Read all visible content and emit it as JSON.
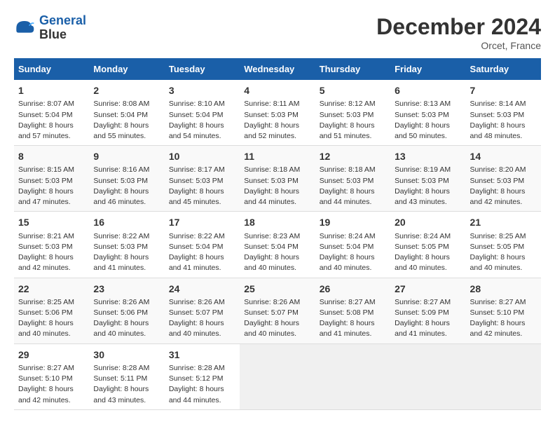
{
  "header": {
    "logo_line1": "General",
    "logo_line2": "Blue",
    "month": "December 2024",
    "location": "Orcet, France"
  },
  "days_of_week": [
    "Sunday",
    "Monday",
    "Tuesday",
    "Wednesday",
    "Thursday",
    "Friday",
    "Saturday"
  ],
  "weeks": [
    [
      {
        "num": "1",
        "sr": "8:07 AM",
        "ss": "5:04 PM",
        "dl": "8 hours and 57 minutes."
      },
      {
        "num": "2",
        "sr": "8:08 AM",
        "ss": "5:04 PM",
        "dl": "8 hours and 55 minutes."
      },
      {
        "num": "3",
        "sr": "8:10 AM",
        "ss": "5:04 PM",
        "dl": "8 hours and 54 minutes."
      },
      {
        "num": "4",
        "sr": "8:11 AM",
        "ss": "5:03 PM",
        "dl": "8 hours and 52 minutes."
      },
      {
        "num": "5",
        "sr": "8:12 AM",
        "ss": "5:03 PM",
        "dl": "8 hours and 51 minutes."
      },
      {
        "num": "6",
        "sr": "8:13 AM",
        "ss": "5:03 PM",
        "dl": "8 hours and 50 minutes."
      },
      {
        "num": "7",
        "sr": "8:14 AM",
        "ss": "5:03 PM",
        "dl": "8 hours and 48 minutes."
      }
    ],
    [
      {
        "num": "8",
        "sr": "8:15 AM",
        "ss": "5:03 PM",
        "dl": "8 hours and 47 minutes."
      },
      {
        "num": "9",
        "sr": "8:16 AM",
        "ss": "5:03 PM",
        "dl": "8 hours and 46 minutes."
      },
      {
        "num": "10",
        "sr": "8:17 AM",
        "ss": "5:03 PM",
        "dl": "8 hours and 45 minutes."
      },
      {
        "num": "11",
        "sr": "8:18 AM",
        "ss": "5:03 PM",
        "dl": "8 hours and 44 minutes."
      },
      {
        "num": "12",
        "sr": "8:18 AM",
        "ss": "5:03 PM",
        "dl": "8 hours and 44 minutes."
      },
      {
        "num": "13",
        "sr": "8:19 AM",
        "ss": "5:03 PM",
        "dl": "8 hours and 43 minutes."
      },
      {
        "num": "14",
        "sr": "8:20 AM",
        "ss": "5:03 PM",
        "dl": "8 hours and 42 minutes."
      }
    ],
    [
      {
        "num": "15",
        "sr": "8:21 AM",
        "ss": "5:03 PM",
        "dl": "8 hours and 42 minutes."
      },
      {
        "num": "16",
        "sr": "8:22 AM",
        "ss": "5:03 PM",
        "dl": "8 hours and 41 minutes."
      },
      {
        "num": "17",
        "sr": "8:22 AM",
        "ss": "5:04 PM",
        "dl": "8 hours and 41 minutes."
      },
      {
        "num": "18",
        "sr": "8:23 AM",
        "ss": "5:04 PM",
        "dl": "8 hours and 40 minutes."
      },
      {
        "num": "19",
        "sr": "8:24 AM",
        "ss": "5:04 PM",
        "dl": "8 hours and 40 minutes."
      },
      {
        "num": "20",
        "sr": "8:24 AM",
        "ss": "5:05 PM",
        "dl": "8 hours and 40 minutes."
      },
      {
        "num": "21",
        "sr": "8:25 AM",
        "ss": "5:05 PM",
        "dl": "8 hours and 40 minutes."
      }
    ],
    [
      {
        "num": "22",
        "sr": "8:25 AM",
        "ss": "5:06 PM",
        "dl": "8 hours and 40 minutes."
      },
      {
        "num": "23",
        "sr": "8:26 AM",
        "ss": "5:06 PM",
        "dl": "8 hours and 40 minutes."
      },
      {
        "num": "24",
        "sr": "8:26 AM",
        "ss": "5:07 PM",
        "dl": "8 hours and 40 minutes."
      },
      {
        "num": "25",
        "sr": "8:26 AM",
        "ss": "5:07 PM",
        "dl": "8 hours and 40 minutes."
      },
      {
        "num": "26",
        "sr": "8:27 AM",
        "ss": "5:08 PM",
        "dl": "8 hours and 41 minutes."
      },
      {
        "num": "27",
        "sr": "8:27 AM",
        "ss": "5:09 PM",
        "dl": "8 hours and 41 minutes."
      },
      {
        "num": "28",
        "sr": "8:27 AM",
        "ss": "5:10 PM",
        "dl": "8 hours and 42 minutes."
      }
    ],
    [
      {
        "num": "29",
        "sr": "8:27 AM",
        "ss": "5:10 PM",
        "dl": "8 hours and 42 minutes."
      },
      {
        "num": "30",
        "sr": "8:28 AM",
        "ss": "5:11 PM",
        "dl": "8 hours and 43 minutes."
      },
      {
        "num": "31",
        "sr": "8:28 AM",
        "ss": "5:12 PM",
        "dl": "8 hours and 44 minutes."
      },
      null,
      null,
      null,
      null
    ]
  ],
  "labels": {
    "sunrise": "Sunrise:",
    "sunset": "Sunset:",
    "daylight": "Daylight:"
  }
}
